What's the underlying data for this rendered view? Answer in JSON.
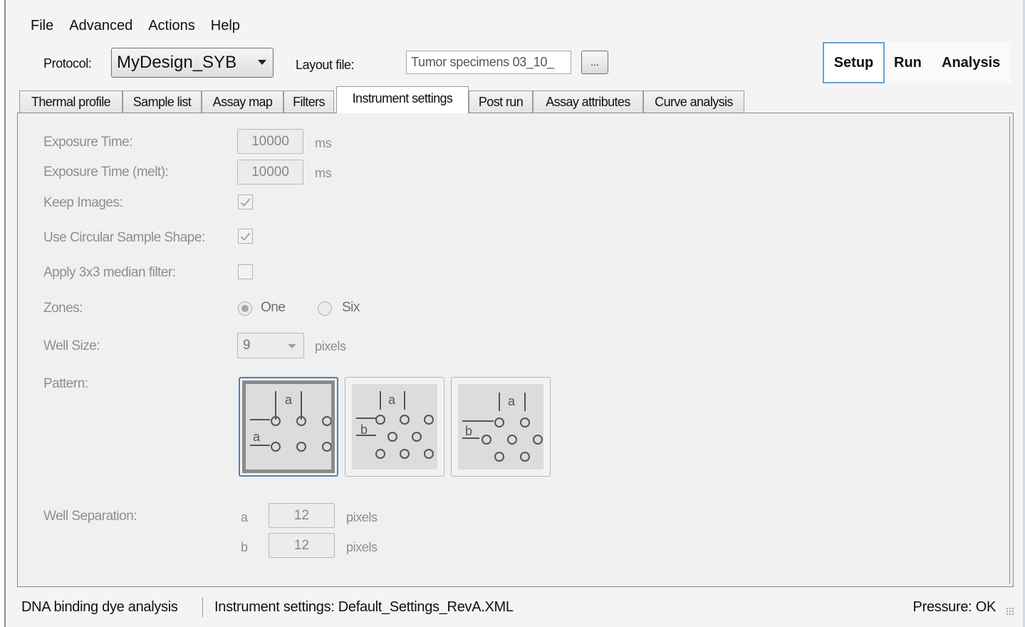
{
  "menu": [
    "File",
    "Advanced",
    "Actions",
    "Help"
  ],
  "protocol": {
    "label": "Protocol:",
    "value": "MyDesign_SYB"
  },
  "layout_file": {
    "label": "Layout file:",
    "value": "Tumor specimens 03_10_",
    "browse": "..."
  },
  "mode_tabs": {
    "setup": "Setup",
    "run": "Run",
    "analysis": "Analysis",
    "active": "Setup"
  },
  "tabs": [
    "Thermal profile",
    "Sample list",
    "Assay map",
    "Filters",
    "Instrument settings",
    "Post run",
    "Assay attributes",
    "Curve analysis"
  ],
  "active_tab": "Instrument settings",
  "form": {
    "exposure_time": {
      "label": "Exposure Time:",
      "value": "10000",
      "unit": "ms"
    },
    "exposure_time_melt": {
      "label": "Exposure Time (melt):",
      "value": "10000",
      "unit": "ms"
    },
    "keep_images": {
      "label": "Keep Images:",
      "checked": true
    },
    "circular_shape": {
      "label": "Use Circular Sample Shape:",
      "checked": true
    },
    "median_filter": {
      "label": "Apply 3x3 median filter:",
      "checked": false
    },
    "zones": {
      "label": "Zones:",
      "option_one": "One",
      "option_six": "Six",
      "selected": "One"
    },
    "well_size": {
      "label": "Well Size:",
      "value": "9",
      "unit": "pixels"
    },
    "pattern": {
      "label": "Pattern:",
      "selected_index": 0,
      "letter_a": "a",
      "letter_b": "b"
    },
    "well_separation": {
      "label": "Well Separation:",
      "a_label": "a",
      "a_value": "12",
      "b_label": "b",
      "b_value": "12",
      "unit": "pixels"
    }
  },
  "status": {
    "mode": "DNA binding dye analysis",
    "settings": "Instrument settings: Default_Settings_RevA.XML",
    "pressure": "Pressure: OK"
  }
}
